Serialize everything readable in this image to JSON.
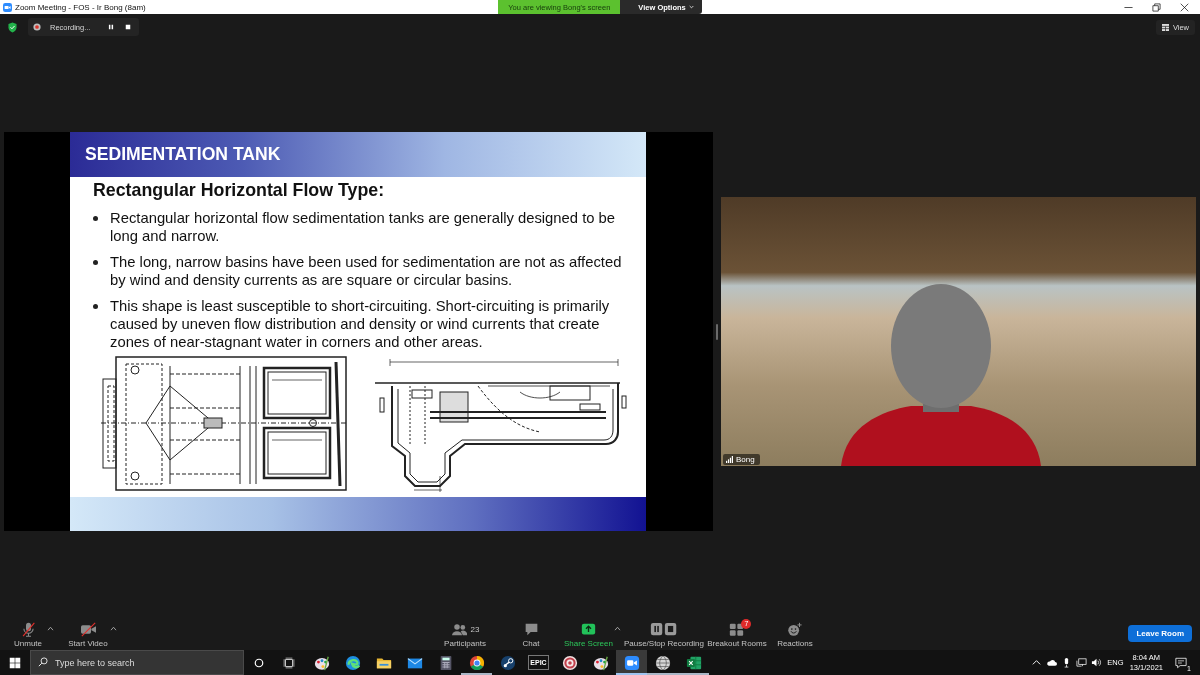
{
  "window": {
    "title": "Zoom Meeting - FOS - Ir Bong (8am)"
  },
  "share_banner": {
    "message": "You are viewing Bong's screen",
    "view_options": "View Options"
  },
  "recording": {
    "label": "Recording..."
  },
  "view_button": {
    "label": "View"
  },
  "slide": {
    "title": "SEDIMENTATION TANK",
    "heading": "Rectangular Horizontal Flow Type:",
    "bullets": [
      "Rectangular horizontal flow sedimentation tanks are generally designed to be long and narrow.",
      "The long, narrow basins have been used for sedimentation are not as affected by wind and density currents as are square or circular basins.",
      "This shape is least susceptible to short-circuiting. Short-circuiting is primarily caused by uneven flow distribution and density or wind currents that create zones of near-stagnant water in corners and other areas."
    ]
  },
  "video": {
    "name": "Bong"
  },
  "toolbar": {
    "left": [
      {
        "kind": "mic",
        "label": "Unmute",
        "off": true,
        "menu": true
      },
      {
        "kind": "camera",
        "label": "Start Video",
        "off": true,
        "menu": true
      }
    ],
    "center": [
      {
        "kind": "participants",
        "label": "Participants",
        "count": "23",
        "menu": false
      },
      {
        "kind": "chat",
        "label": "Chat",
        "menu": false
      },
      {
        "kind": "share",
        "label": "Share Screen",
        "menu": true
      },
      {
        "kind": "recording",
        "label": "Pause/Stop Recording",
        "menu": false
      },
      {
        "kind": "breakout",
        "label": "Breakout Rooms",
        "badge": "7",
        "menu": false
      },
      {
        "kind": "reactions",
        "label": "Reactions",
        "menu": false
      }
    ],
    "leave": {
      "label": "Leave Room"
    }
  },
  "taskbar": {
    "search": {
      "placeholder": "Type here to search"
    },
    "apps": [
      {
        "kind": "palette",
        "open": false,
        "selected": false
      },
      {
        "kind": "swirl",
        "open": false,
        "selected": false
      },
      {
        "kind": "folder",
        "open": false,
        "selected": false
      },
      {
        "kind": "envelope",
        "open": false,
        "selected": false
      },
      {
        "kind": "calculator",
        "open": false,
        "selected": false
      },
      {
        "kind": "ring",
        "open": true,
        "selected": false
      },
      {
        "kind": "disc",
        "open": false,
        "selected": false
      },
      {
        "kind": "label-tile",
        "label": "EPIC",
        "open": false,
        "selected": false
      },
      {
        "kind": "target",
        "open": false,
        "selected": false
      },
      {
        "kind": "palette",
        "open": false,
        "selected": false
      },
      {
        "kind": "camera-tile",
        "open": true,
        "selected": true
      },
      {
        "kind": "globe",
        "open": true,
        "selected": false
      },
      {
        "kind": "spreadsheet",
        "open": true,
        "selected": false
      }
    ],
    "tray": {
      "language": "ENG",
      "time": "8:04 AM",
      "date": "13/1/2021",
      "notifications": "1"
    }
  }
}
